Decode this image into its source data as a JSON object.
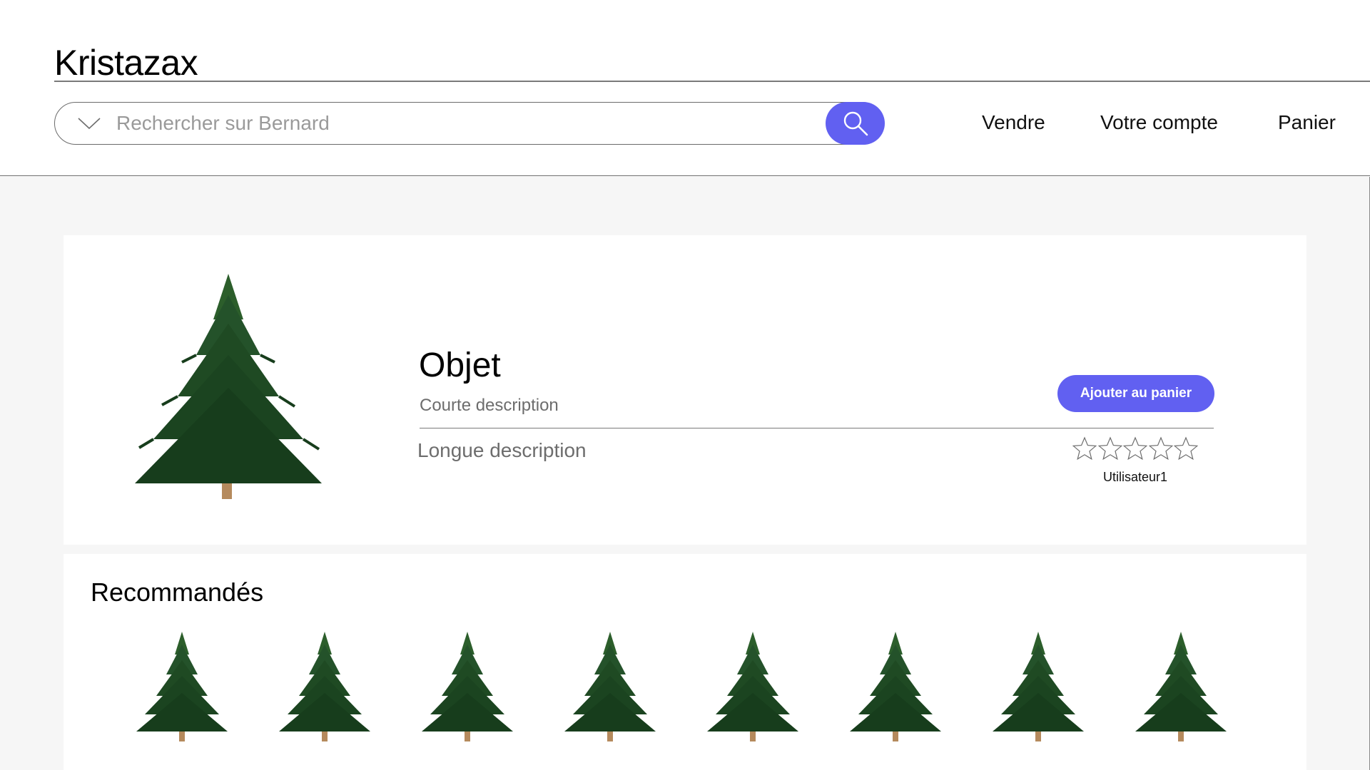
{
  "header": {
    "brand": "Kristazax",
    "search": {
      "placeholder": "Rechercher sur Bernard",
      "value": ""
    },
    "nav": {
      "sell": "Vendre",
      "account": "Votre compte",
      "cart": "Panier"
    }
  },
  "product": {
    "title": "Objet",
    "short_description": "Courte description",
    "long_description": "Longue description",
    "add_to_cart": "Ajouter au panier",
    "rating_max": 5,
    "rating": 0,
    "reviewer": "Utilisateur1",
    "image_icon": "fir-tree-icon"
  },
  "recommendations": {
    "title": "Recommandés",
    "count": 8,
    "item_icon": "fir-tree-icon"
  },
  "colors": {
    "accent": "#6160f1",
    "page_background": "#f6f6f6",
    "tree_green": "#1f4a23"
  }
}
